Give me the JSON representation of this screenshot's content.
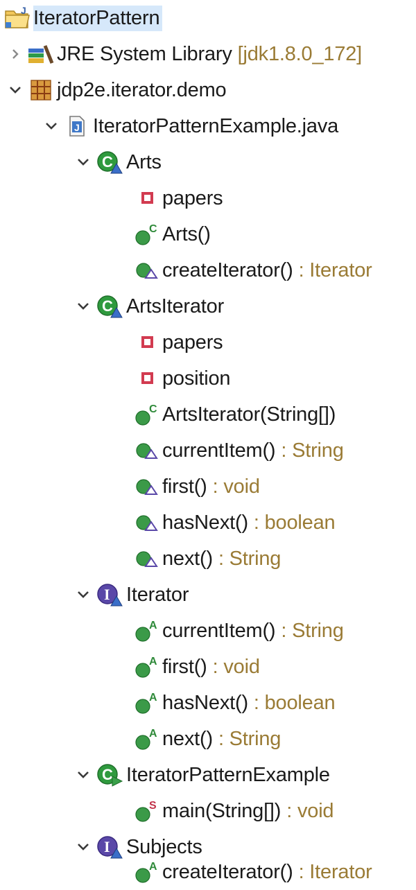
{
  "project": {
    "name": "IteratorPattern"
  },
  "library": {
    "name": "JRE System Library",
    "decoration": "[jdk1.8.0_172]"
  },
  "package": {
    "name": "jdp2e.iterator.demo"
  },
  "file": {
    "name": "IteratorPatternExample.java"
  },
  "types": {
    "arts": {
      "name": "Arts",
      "members": [
        {
          "label": "papers",
          "decoration": ""
        },
        {
          "label": "Arts()",
          "decoration": ""
        },
        {
          "label": "createIterator()",
          "decoration": ": Iterator"
        }
      ]
    },
    "arts_iterator": {
      "name": "ArtsIterator",
      "members": [
        {
          "label": "papers",
          "decoration": ""
        },
        {
          "label": "position",
          "decoration": ""
        },
        {
          "label": "ArtsIterator(String[])",
          "decoration": ""
        },
        {
          "label": "currentItem()",
          "decoration": ": String"
        },
        {
          "label": "first()",
          "decoration": ": void"
        },
        {
          "label": "hasNext()",
          "decoration": ": boolean"
        },
        {
          "label": "next()",
          "decoration": ": String"
        }
      ]
    },
    "iterator": {
      "name": "Iterator",
      "members": [
        {
          "label": "currentItem()",
          "decoration": ": String"
        },
        {
          "label": "first()",
          "decoration": ": void"
        },
        {
          "label": "hasNext()",
          "decoration": ": boolean"
        },
        {
          "label": "next()",
          "decoration": ": String"
        }
      ]
    },
    "example": {
      "name": "IteratorPatternExample",
      "members": [
        {
          "label": "main(String[])",
          "decoration": ": void"
        }
      ]
    },
    "subjects": {
      "name": "Subjects",
      "members": [
        {
          "label": "createIterator()",
          "decoration": ": Iterator"
        }
      ]
    }
  },
  "colors": {
    "decoration": "#9a7b35",
    "method_green": "#3b9a48",
    "class_green": "#2f9a3e",
    "interface_purple": "#5a48a8",
    "field_red": "#d23b50",
    "selection": "#d6e8fa"
  },
  "icons": {
    "project": "java-project-icon",
    "library": "library-icon",
    "package": "package-icon",
    "file": "java-file-icon",
    "class": "class-icon",
    "main_class": "main-class-icon",
    "interface": "interface-icon",
    "field": "private-field-icon",
    "constructor": "constructor-icon",
    "method": "default-method-icon",
    "abstract_method": "abstract-method-icon",
    "static_method": "static-method-icon"
  }
}
